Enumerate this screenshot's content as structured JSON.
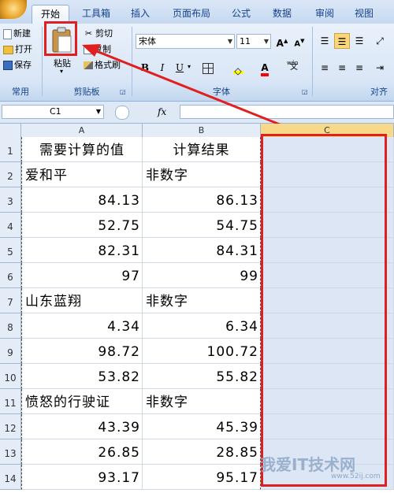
{
  "ribbon": {
    "tabs": [
      "开始",
      "工具箱",
      "插入",
      "页面布局",
      "公式",
      "数据",
      "审阅",
      "视图"
    ],
    "active_tab": "开始",
    "groups": {
      "common": {
        "label": "常用",
        "buttons": [
          "新建",
          "打开",
          "保存"
        ]
      },
      "clipboard": {
        "label": "剪贴板",
        "paste_label": "粘贴",
        "cut_label": "剪切",
        "copy_label": "复制",
        "format_painter_label": "格式刷"
      },
      "font": {
        "label": "字体",
        "font_name": "宋体",
        "font_size": "11",
        "bold": "B",
        "italic": "I",
        "underline": "U",
        "grow": "A",
        "shrink": "A",
        "font_color": "A",
        "phonetic": "文"
      },
      "alignment": {
        "label": "对齐"
      }
    }
  },
  "formula_bar": {
    "name_box": "C1",
    "fx": "fx",
    "value": ""
  },
  "sheet": {
    "columns": [
      "A",
      "B",
      "C"
    ],
    "rows": [
      {
        "num": "1",
        "a": "需要计算的值",
        "b": "计算结果",
        "c": ""
      },
      {
        "num": "2",
        "a": "爱和平",
        "b": "非数字",
        "c": ""
      },
      {
        "num": "3",
        "a": "84.13",
        "b": "86.13",
        "c": ""
      },
      {
        "num": "4",
        "a": "52.75",
        "b": "54.75",
        "c": ""
      },
      {
        "num": "5",
        "a": "82.31",
        "b": "84.31",
        "c": ""
      },
      {
        "num": "6",
        "a": "97",
        "b": "99",
        "c": ""
      },
      {
        "num": "7",
        "a": "山东蓝翔",
        "b": "非数字",
        "c": ""
      },
      {
        "num": "8",
        "a": "4.34",
        "b": "6.34",
        "c": ""
      },
      {
        "num": "9",
        "a": "98.72",
        "b": "100.72",
        "c": ""
      },
      {
        "num": "10",
        "a": "53.82",
        "b": "55.82",
        "c": ""
      },
      {
        "num": "11",
        "a": "愤怒的行驶证",
        "b": "非数字",
        "c": ""
      },
      {
        "num": "12",
        "a": "43.39",
        "b": "45.39",
        "c": ""
      },
      {
        "num": "13",
        "a": "26.85",
        "b": "28.85",
        "c": ""
      },
      {
        "num": "14",
        "a": "93.17",
        "b": "95.17",
        "c": ""
      }
    ]
  },
  "watermark": {
    "text": "我爱IT技术网",
    "url": "www.52ij.com"
  },
  "colors": {
    "annotation": "#e02020",
    "selected_column": "#dce6f4",
    "ribbon": "#dbe7f7"
  }
}
